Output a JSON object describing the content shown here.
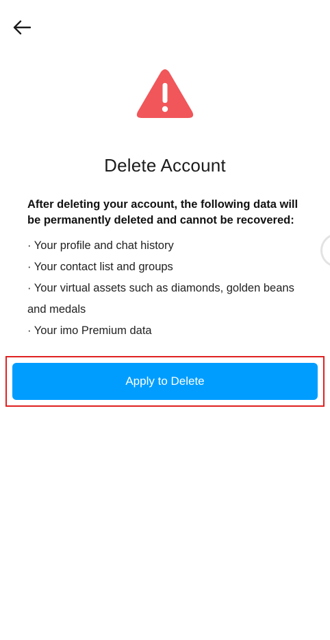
{
  "header": {
    "back_icon": "arrow-left-icon"
  },
  "warning": {
    "icon": "warning-triangle-icon",
    "color": "#f0565a"
  },
  "title": "Delete Account",
  "intro": "After deleting your account, the following data will be permanently deleted and cannot be recovered:",
  "items": [
    "· Your profile and chat history",
    "· Your contact list and groups",
    "· Your virtual assets such as diamonds, golden beans and medals",
    "· Your imo Premium data"
  ],
  "apply_button": {
    "label": "Apply to Delete",
    "color": "#009dff"
  },
  "highlight": {
    "color": "#e02020"
  }
}
